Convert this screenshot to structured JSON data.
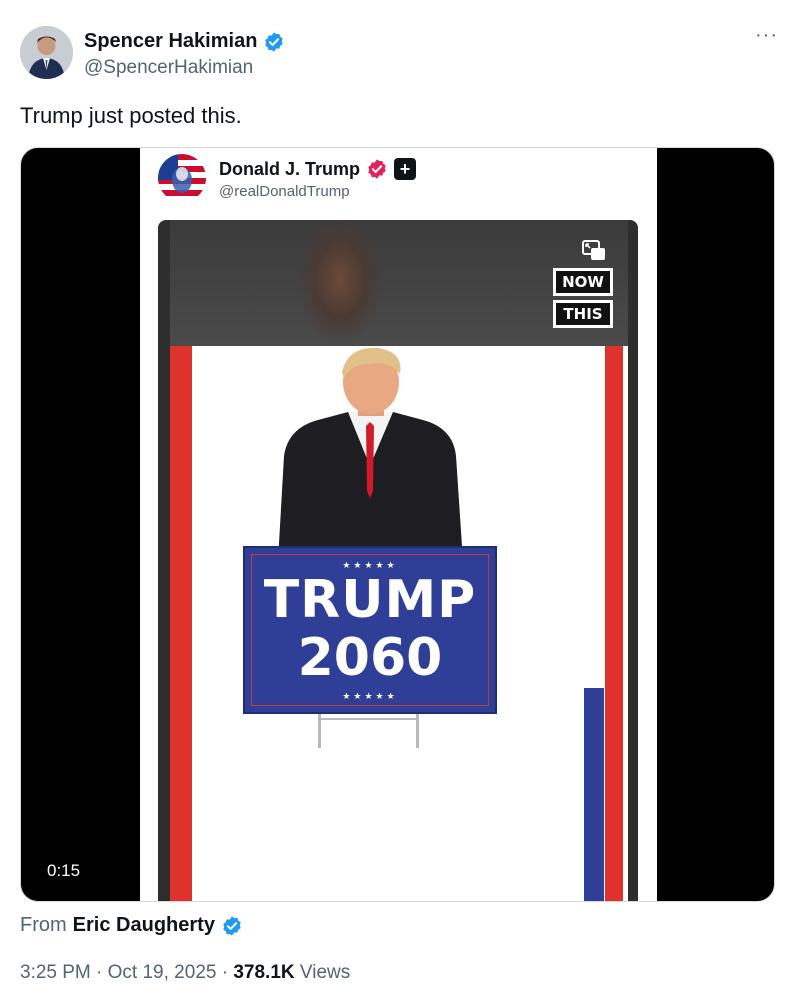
{
  "author": {
    "name": "Spencer Hakimian",
    "handle": "@SpencerHakimian",
    "verified_color": "#1d9bf0"
  },
  "more_label": "···",
  "tweet_text": "Trump just posted this.",
  "embedded_post": {
    "name": "Donald J. Trump",
    "handle": "@realDonaldTrump",
    "badge_color": "#e0245e",
    "plus_label": "+",
    "video": {
      "watermark_line1": "NOW",
      "watermark_line2": "THIS",
      "sign_line1": "TRUMP",
      "sign_line2": "2060",
      "sign_stars": "★★★★★"
    }
  },
  "duration": "0:15",
  "source": {
    "prefix": "From",
    "name": "Eric Daugherty"
  },
  "meta": {
    "time": "3:25 PM",
    "separator": "·",
    "date": "Oct 19, 2025",
    "views_count": "378.1K",
    "views_label": "Views"
  },
  "icons": [
    "avatar",
    "verified-badge-icon",
    "more-icon",
    "pip-icon",
    "plus-badge-icon"
  ]
}
